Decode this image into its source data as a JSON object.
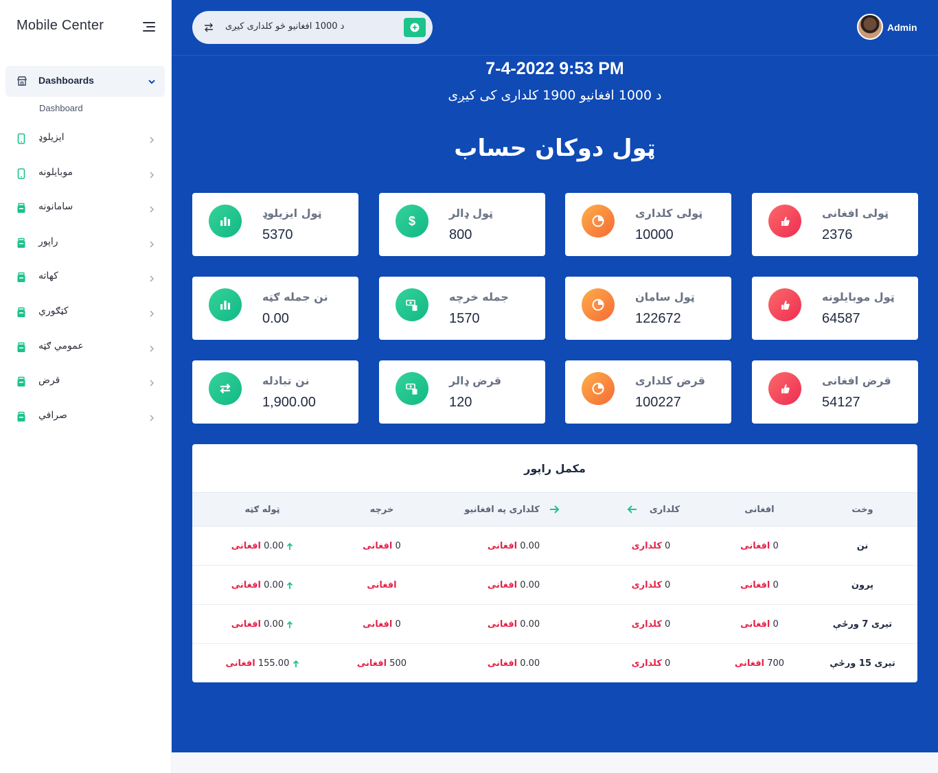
{
  "sidebar": {
    "brand": "Mobile Center",
    "active": {
      "label": "Dashboards",
      "icon": "store-icon"
    },
    "sub_item": "Dashboard",
    "items": [
      {
        "label": "ایزیلوډ",
        "icon": "mobile-icon"
      },
      {
        "label": "موبایلونه",
        "icon": "mobile-icon"
      },
      {
        "label": "سامانونه",
        "icon": "box-icon"
      },
      {
        "label": "راپور",
        "icon": "box-icon"
      },
      {
        "label": "کهاته",
        "icon": "box-icon"
      },
      {
        "label": "کټګوري",
        "icon": "box-icon"
      },
      {
        "label": "عمومي ګټه",
        "icon": "box-icon"
      },
      {
        "label": "قرض",
        "icon": "box-icon"
      },
      {
        "label": "صرافي",
        "icon": "box-icon"
      }
    ]
  },
  "topbar": {
    "search_text": "د 1000 افغانیو څو کلداری کیږی",
    "user_name": "Admin"
  },
  "header": {
    "datetime": "7-4-2022 9:53 PM",
    "rate_text": "د 1000 افغانیو 1900 کلداری کی کیږی",
    "title": "ټول دوکان حساب"
  },
  "cards": [
    {
      "title": "ټولی افغانی",
      "value": "2376",
      "color": "red",
      "icon": "thumb-icon"
    },
    {
      "title": "ټولی کلداری",
      "value": "10000",
      "color": "orange",
      "icon": "pie-chart-icon"
    },
    {
      "title": "ټول ډالر",
      "value": "800",
      "color": "green",
      "icon": "dollar-icon"
    },
    {
      "title": "ټول ایزیلوډ",
      "value": "5370",
      "color": "green",
      "icon": "bar-chart-icon"
    },
    {
      "title": "ټول موبایلونه",
      "value": "64587",
      "color": "red",
      "icon": "thumb-icon"
    },
    {
      "title": "ټول سامان",
      "value": "122672",
      "color": "orange",
      "icon": "pie-chart-icon"
    },
    {
      "title": "جمله خرچه",
      "value": "1570",
      "color": "green",
      "icon": "money-icon"
    },
    {
      "title": "نن جمله ګټه",
      "value": "0.00",
      "color": "green",
      "icon": "bar-chart-icon"
    },
    {
      "title": "قرض افغانی",
      "value": "54127",
      "color": "red",
      "icon": "thumb-icon"
    },
    {
      "title": "قرض کلداری",
      "value": "100227",
      "color": "orange",
      "icon": "pie-chart-icon"
    },
    {
      "title": "قرض ډالر",
      "value": "120",
      "color": "green",
      "icon": "money-icon"
    },
    {
      "title": "نن تبادله",
      "value": "1,900.00",
      "color": "green",
      "icon": "exchange-icon"
    }
  ],
  "report": {
    "title": "مکمل راپور",
    "columns": [
      "وخت",
      "افغانی",
      "کلداری",
      "کلداری په افغانیو",
      "خرچه",
      "ټوله ګټه"
    ],
    "rows": [
      {
        "time": "نن",
        "afghani": "0",
        "afghani_unit": "افغانی",
        "kaldari": "0",
        "kaldari_unit": "کلداری",
        "converted": "0.00",
        "converted_unit": "افغانی",
        "expense": "0",
        "expense_unit": "افغانی",
        "profit": "0.00",
        "profit_unit": "افغانی"
      },
      {
        "time": "پرون",
        "afghani": "0",
        "afghani_unit": "افغانی",
        "kaldari": "0",
        "kaldari_unit": "کلداری",
        "converted": "0.00",
        "converted_unit": "افغانی",
        "expense": "",
        "expense_unit": "افغانی",
        "profit": "0.00",
        "profit_unit": "افغانی"
      },
      {
        "time": "تیری 7 ورځې",
        "afghani": "0",
        "afghani_unit": "افغانی",
        "kaldari": "0",
        "kaldari_unit": "کلداری",
        "converted": "0.00",
        "converted_unit": "افغانی",
        "expense": "0",
        "expense_unit": "افغانی",
        "profit": "0.00",
        "profit_unit": "افغانی"
      },
      {
        "time": "تیری 15 ورځې",
        "afghani": "700",
        "afghani_unit": "افغانی",
        "kaldari": "0",
        "kaldari_unit": "کلداری",
        "converted": "0.00",
        "converted_unit": "افغانی",
        "expense": "500",
        "expense_unit": "افغانی",
        "profit": "155.00",
        "profit_unit": "افغانی"
      }
    ]
  },
  "colors": {
    "primary": "#0f4ab5",
    "green": "#1cc38a",
    "red": "#e5234a",
    "orange": "#f66a35"
  }
}
